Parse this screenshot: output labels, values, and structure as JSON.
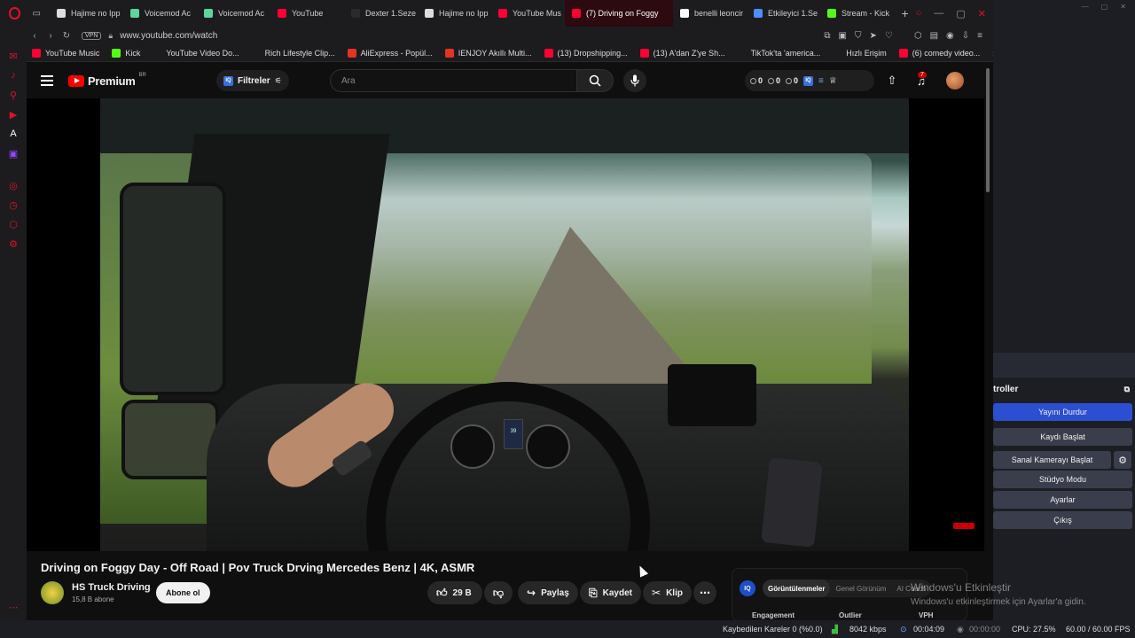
{
  "browser": {
    "tabs": [
      {
        "label": "Hajime no Ipp",
        "icon": "a-icon",
        "color": "#dddddd"
      },
      {
        "label": "Voicemod Ac",
        "icon": "voicemod-icon",
        "color": "#5cd69a"
      },
      {
        "label": "Voicemod Ac",
        "icon": "voicemod-icon",
        "color": "#5cd69a"
      },
      {
        "label": "YouTube",
        "icon": "youtube-icon",
        "color": "#ff0033"
      },
      {
        "label": "Dexter 1.Seze",
        "icon": "blank-icon",
        "color": "#2a2a2a"
      },
      {
        "label": "Hajime no Ipp",
        "icon": "a-icon",
        "color": "#dddddd"
      },
      {
        "label": "YouTube Mus",
        "icon": "ytmusic-icon",
        "color": "#ff0033"
      },
      {
        "label": "(7) Driving on Foggy",
        "icon": "youtube-icon",
        "color": "#ff0033",
        "active": true
      },
      {
        "label": "benelli leoncir",
        "icon": "google-icon",
        "color": "#ffffff"
      },
      {
        "label": "Etkileyici 1.Se",
        "icon": "shield-icon",
        "color": "#4f8cff"
      },
      {
        "label": "Stream - Kick",
        "icon": "kick-icon",
        "color": "#53fc18"
      }
    ],
    "url": "www.youtube.com/watch",
    "vpn_label": "VPN",
    "bookmarks": [
      {
        "label": "YouTube Music",
        "color": "#ff0033",
        "icon": "ytmusic-icon"
      },
      {
        "label": "Kick",
        "color": "#53fc18",
        "icon": "kick-icon"
      },
      {
        "label": "YouTube Video Do...",
        "color": "#1c1c1e",
        "icon": "tiktok-icon"
      },
      {
        "label": "Rich Lifestyle Clip...",
        "color": "#1c1c1e",
        "icon": "tiktok-icon"
      },
      {
        "label": "AliExpress - Popül...",
        "color": "#e43225",
        "icon": "aliexpress-icon"
      },
      {
        "label": "IENJOY Akıllı Multi...",
        "color": "#e43225",
        "icon": "aliexpress-icon"
      },
      {
        "label": "(13) Dropshipping...",
        "color": "#ff0033",
        "icon": "youtube-icon"
      },
      {
        "label": "(13) A'dan Z'ye Sh...",
        "color": "#ff0033",
        "icon": "youtube-icon"
      },
      {
        "label": "TikTok'ta 'america...",
        "color": "#1c1c1e",
        "icon": "tiktok-icon"
      },
      {
        "label": "Hızlı Erişim",
        "color": "#1c1c1e",
        "icon": "grid-icon"
      },
      {
        "label": "(6) comedy video...",
        "color": "#ff0033",
        "icon": "youtube-icon"
      }
    ]
  },
  "youtube": {
    "logo_text": "Premium",
    "region": "BR",
    "filter_label": "Filtreler",
    "search_placeholder": "Ara",
    "counters": [
      "0",
      "0",
      "0"
    ],
    "notification_count": "7",
    "video": {
      "title": "Driving on Foggy Day - Off Road | Pov Truck Drving Mercedes Benz | 4K, ASMR",
      "dash_readout": "39"
    },
    "channel": {
      "name": "HS Truck Driving",
      "subscribers": "15,8 B abone",
      "subscribe_label": "Abone ol"
    },
    "actions": {
      "like_count": "29 B",
      "share_label": "Paylaş",
      "save_label": "Kaydet",
      "clip_label": "Klip"
    },
    "analytics": {
      "iq_label": "IQ",
      "tabs": [
        "Görüntülenmeler",
        "Genel Görünüm",
        "AI Coach"
      ],
      "columns": [
        "Engagement",
        "Outlier",
        "VPH"
      ]
    }
  },
  "obs": {
    "dock_title": "troller",
    "buttons": [
      "Yayını Durdur",
      "Kaydı Başlat",
      "Sanal Kamerayı Başlat",
      "Stüdyo Modu",
      "Ayarlar",
      "Çıkış"
    ],
    "watermark_title": "Windows'u Etkinleştir",
    "watermark_sub": "Windows'u etkinleştirmek için Ayarlar'a gidin."
  },
  "status": {
    "dropped_frames": "Kaybedilen Kareler 0 (%0.0)",
    "bitrate": "8042 kbps",
    "stream_time": "00:04:09",
    "record_time": "00:00:00",
    "cpu": "CPU: 27.5%",
    "fps": "60.00 / 60.00 FPS"
  }
}
